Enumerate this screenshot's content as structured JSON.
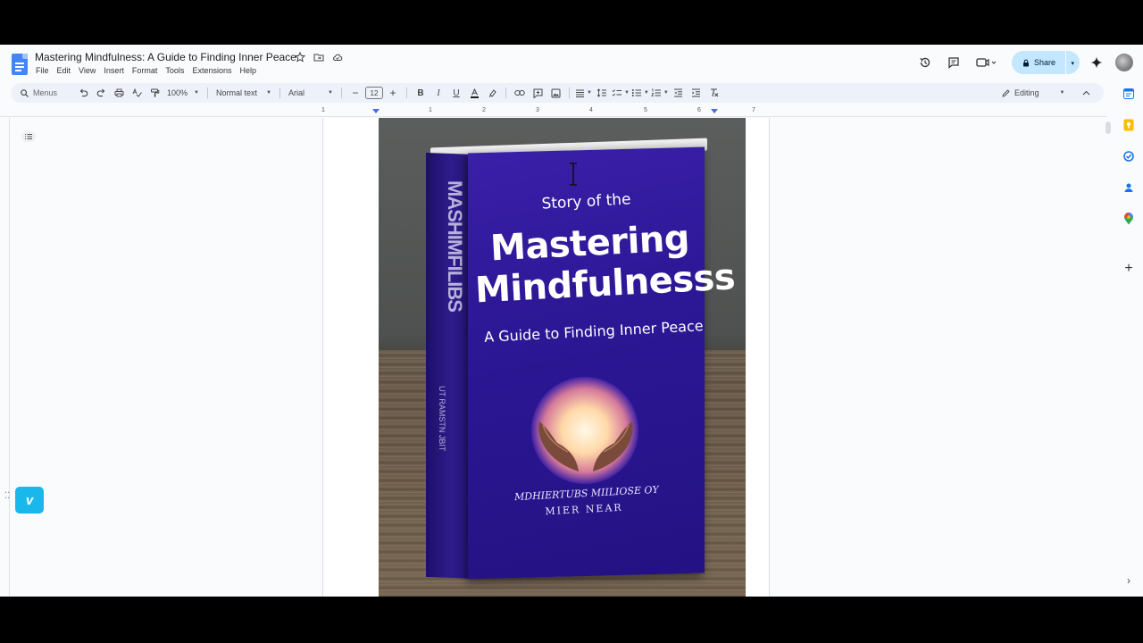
{
  "document": {
    "title": "Mastering Mindfulness: A Guide to Finding Inner Peace"
  },
  "menu": [
    "File",
    "Edit",
    "View",
    "Insert",
    "Format",
    "Tools",
    "Extensions",
    "Help"
  ],
  "header": {
    "share_label": "Share"
  },
  "toolbar": {
    "search_label": "Menus",
    "zoom": "100%",
    "paragraph_style": "Normal text",
    "font": "Arial",
    "font_size": "12",
    "mode": "Editing"
  },
  "ruler": {
    "numbers": [
      "1",
      "1",
      "2",
      "3",
      "4",
      "5",
      "6",
      "7"
    ]
  },
  "book_image": {
    "cover_line_1": "Story of the",
    "cover_line_2": "Mastering",
    "cover_line_3": "Mindfulnesss",
    "cover_line_4": "A Guide to Finding Inner Peace",
    "cover_author_1": "MDHIERTUBS MIILIOSE OY",
    "cover_author_2": "MIER NEAR",
    "spine_text": "MASHIMFILIBS",
    "spine_sub": "UT RAMSTN JBIT"
  },
  "colors": {
    "share_bg": "#c2e7ff",
    "toolbar_bg": "#edf2fa",
    "page_bg": "#ffffff",
    "app_bg": "#f9fbfd",
    "docs_blue": "#4285f4",
    "cover_purple": "#2c1795",
    "vimeo_blue": "#1ab7ea"
  },
  "icons": {
    "star": "star-icon",
    "move": "folder-move-icon",
    "cloud": "cloud-status-icon",
    "history": "history-icon",
    "comments": "comment-icon",
    "meet": "video-call-icon",
    "gemini": "gemini-spark-icon",
    "widget": "vimeo-icon"
  }
}
